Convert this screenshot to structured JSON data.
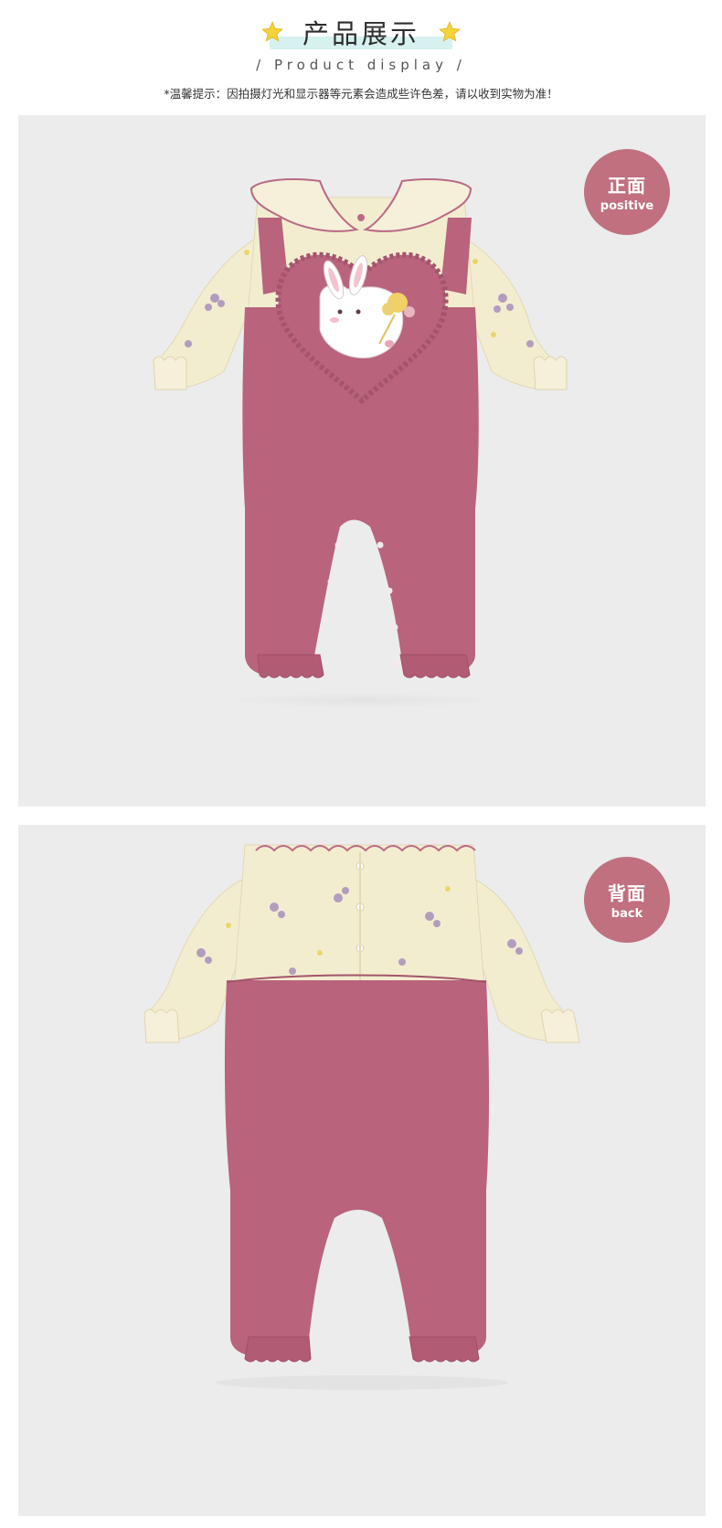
{
  "header": {
    "title": "产品展示",
    "subtitle": "/ Product display /",
    "notice": "*温馨提示：因拍摄灯光和显示器等元素会造成些许色差，请以收到实物为准！"
  },
  "colors": {
    "accent_bar": "#d6f1ef",
    "star": "#f4d33a",
    "badge": "#c0707f",
    "panel_bg": "#ececec",
    "romper_pink": "#b9637c",
    "shirt_cream": "#f3edd0"
  },
  "panels": [
    {
      "badge_cn": "正面",
      "badge_en": "positive",
      "view": "front"
    },
    {
      "badge_cn": "背面",
      "badge_en": "back",
      "view": "back"
    }
  ]
}
